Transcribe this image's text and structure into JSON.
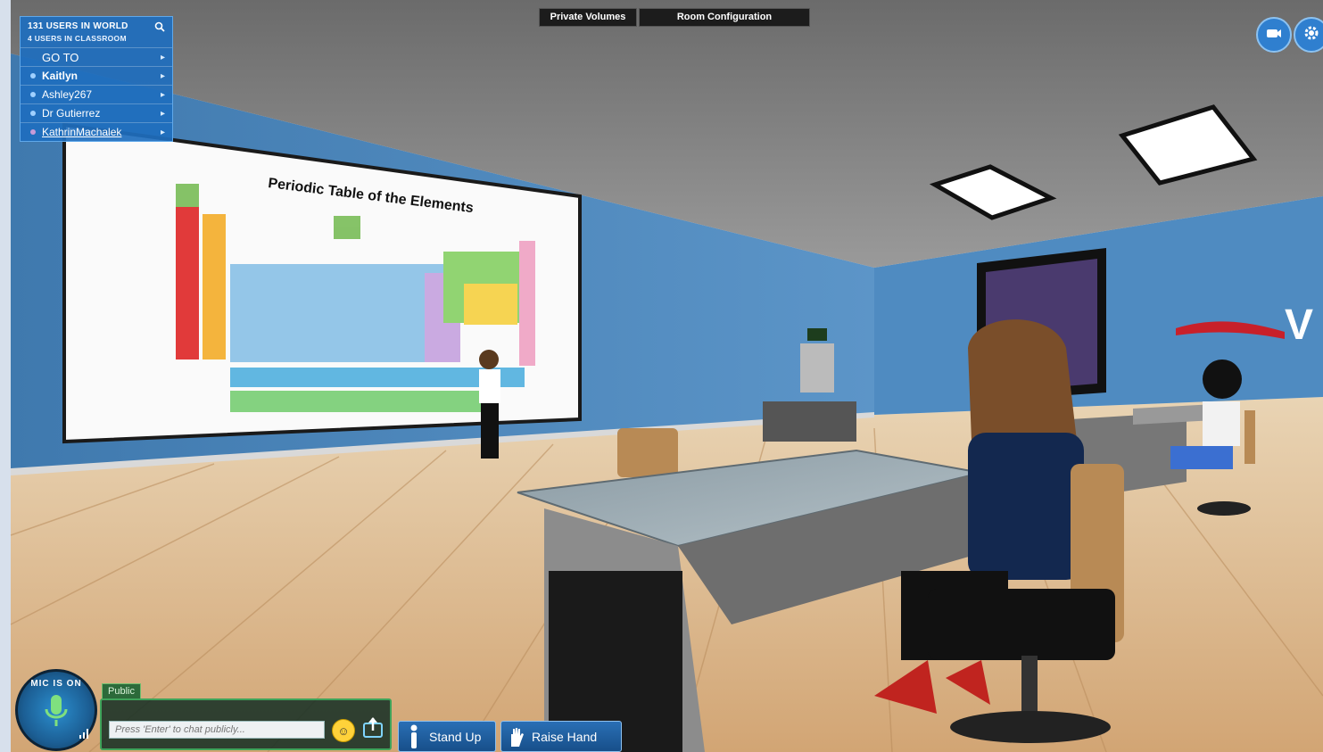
{
  "users_panel": {
    "world_count": "131 USERS IN WORLD",
    "classroom_count": "4 USERS IN CLASSROOM",
    "goto_label": "GO TO",
    "users": [
      {
        "name": "Kaitlyn"
      },
      {
        "name": "Ashley267"
      },
      {
        "name": "Dr Gutierrez"
      },
      {
        "name": "KathrinMachalek"
      }
    ],
    "search_icon": "search-icon",
    "chevron_icon": "chevron-right-icon"
  },
  "top_tabs": [
    "Private Volumes",
    "Room Configuration"
  ],
  "top_right": {
    "buttons": [
      "camera-icon",
      "settings-icon"
    ]
  },
  "scene": {
    "screen_title": "Periodic Table of the Elements",
    "logo_text": "V"
  },
  "chat": {
    "channel_tab": "Public",
    "placeholder": "Press 'Enter' to chat publicly...",
    "mic_status": "MIC IS ON"
  },
  "actions": {
    "stand_up": "Stand Up",
    "raise_hand": "Raise Hand"
  },
  "colors": {
    "wall": "#4a87bd",
    "floor": "#dcb98d",
    "panel": "#1e6ebe",
    "accent_green": "#3fa35a"
  }
}
